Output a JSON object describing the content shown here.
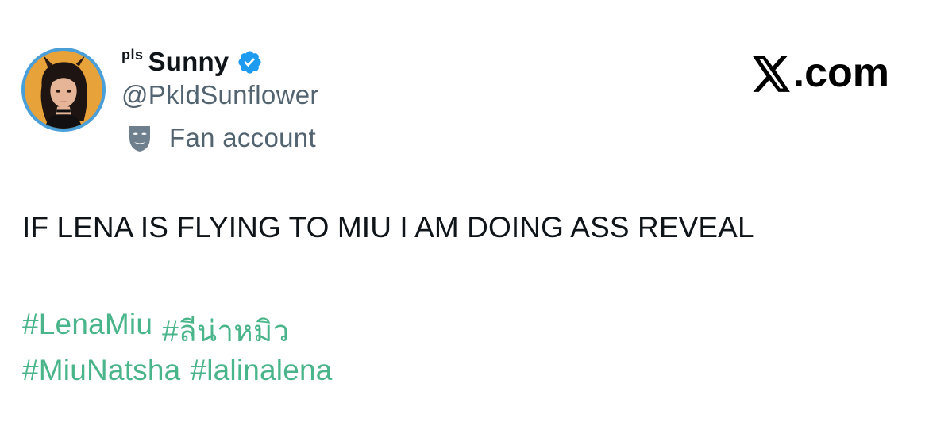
{
  "post": {
    "name_prefix": "pls",
    "display_name": "Sunny",
    "handle": "@PkldSunflower",
    "account_label": "Fan account",
    "text": "IF LENA IS FLYING TO MIU I AM DOING ASS REVEAL",
    "hashtags": [
      [
        "#LenaMiu",
        "#ลีน่าหมิว"
      ],
      [
        "#MiuNatsha",
        "#lalinalena"
      ]
    ]
  },
  "brand": {
    "suffix": ".com"
  },
  "colors": {
    "hashtag": "#4ab58a",
    "verified": "#1d9bf0",
    "secondary_text": "#536471",
    "avatar_ring": "#4a9fd9",
    "avatar_bg": "#e8a23a"
  },
  "icons": [
    "avatar-image",
    "verified-badge-icon",
    "mask-icon",
    "x-logo-icon"
  ]
}
